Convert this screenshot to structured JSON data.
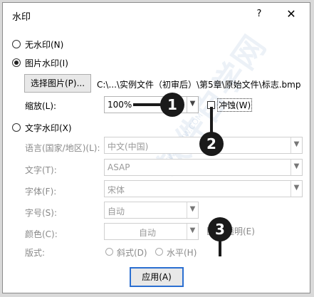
{
  "window": {
    "title": "水印",
    "help_glyph": "?",
    "close_glyph": "✕"
  },
  "no_watermark": {
    "label": "无水印(N)"
  },
  "picture_watermark": {
    "label": "图片水印(I)",
    "select_button": "选择图片(P)...",
    "file_path": "C:\\...\\实例文件（初审后）\\第5章\\原始文件\\标志.bmp",
    "scale_label": "缩放(L):",
    "scale_value": "100%",
    "washout_label": "冲蚀(W)"
  },
  "text_watermark": {
    "label": "文字水印(X)",
    "language_label": "语言(国家/地区)(L):",
    "language_value": "中文(中国)",
    "text_label": "文字(T):",
    "text_value": "ASAP",
    "font_label": "字体(F):",
    "font_value": "宋体",
    "size_label": "字号(S):",
    "size_value": "自动",
    "color_label": "颜色(C):",
    "color_value": "自动",
    "semitransparent_label": "半透明(E)",
    "layout_label": "版式:",
    "diagonal_label": "斜式(D)",
    "horizontal_label": "水平(H)"
  },
  "apply_button": "应用(A)",
  "markers": [
    "1",
    "2",
    "3"
  ],
  "watermark_text": "软件自学网",
  "watermark_url": "WWW.RJZXW.COM",
  "colors": {
    "accent": "#2b6fd1",
    "marker": "#1a1a1a"
  }
}
